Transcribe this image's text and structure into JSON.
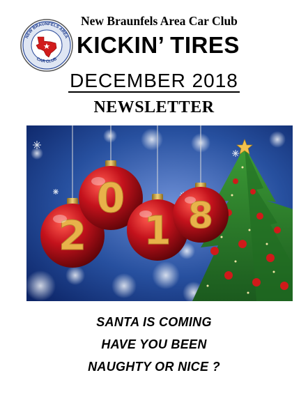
{
  "header": {
    "club_name": "New Braunfels Area Car Club",
    "newsletter_title": "KICKIN’ TIRES",
    "logo_text_top": "NEW BRAUNFELS AREA",
    "logo_text_bottom": "CAR CLUB"
  },
  "issue": {
    "month_year": "DECEMBER 2018",
    "label": "NEWSLETTER"
  },
  "photo": {
    "ornament_digits": [
      "2",
      "0",
      "1",
      "8"
    ]
  },
  "tagline": {
    "line1": "SANTA IS COMING",
    "line2": "HAVE YOU BEEN",
    "line3": "NAUGHTY OR NICE ?"
  },
  "colors": {
    "ornament_red": "#c4121c",
    "glitter_gold": "#e8b24a",
    "tree_green": "#2f7d2a",
    "sky_blue": "#123a8a"
  }
}
